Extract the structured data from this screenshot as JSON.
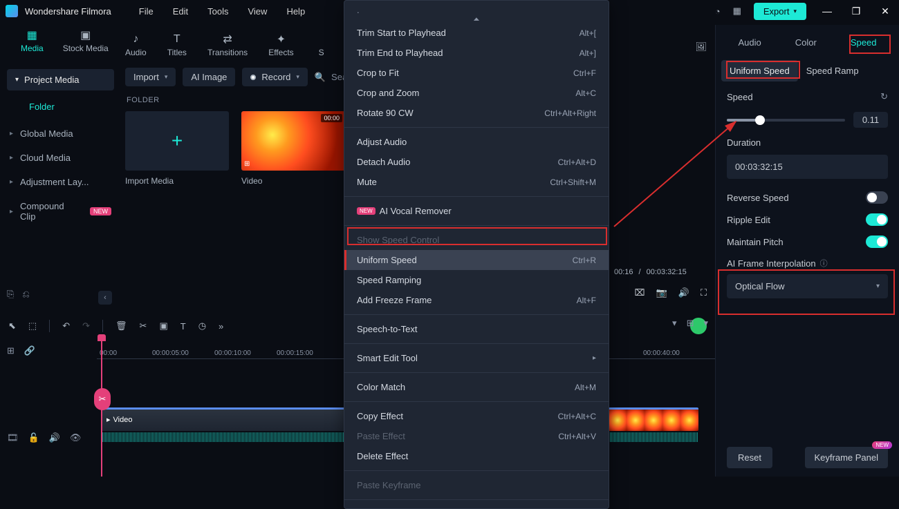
{
  "app": {
    "name": "Wondershare Filmora"
  },
  "menubar": [
    "File",
    "Edit",
    "Tools",
    "View",
    "Help"
  ],
  "export_label": "Export",
  "top_tabs": [
    {
      "label": "Media",
      "icon": "▦",
      "active": true
    },
    {
      "label": "Stock Media",
      "icon": "▣"
    },
    {
      "label": "Audio",
      "icon": "♪"
    },
    {
      "label": "Titles",
      "icon": "T"
    },
    {
      "label": "Transitions",
      "icon": "⇄"
    },
    {
      "label": "Effects",
      "icon": "✦"
    },
    {
      "label": "S",
      "icon": ""
    }
  ],
  "sidebar": {
    "header": "Project Media",
    "folder_label": "Folder",
    "items": [
      {
        "label": "Global Media"
      },
      {
        "label": "Cloud Media"
      },
      {
        "label": "Adjustment Lay..."
      },
      {
        "label": "Compound Clip",
        "new": true
      }
    ]
  },
  "toolbar": {
    "import": "Import",
    "ai_image": "AI Image",
    "record": "Record",
    "search_placeholder": "Sear"
  },
  "folder_heading": "FOLDER",
  "thumbs": {
    "import_media": "Import Media",
    "video": {
      "label": "Video",
      "duration": "00:00"
    }
  },
  "context_menu": {
    "groups": [
      [
        {
          "label": "Trim Start to Playhead",
          "shortcut": "Alt+["
        },
        {
          "label": "Trim End to Playhead",
          "shortcut": "Alt+]"
        },
        {
          "label": "Crop to Fit",
          "shortcut": "Ctrl+F"
        },
        {
          "label": "Crop and Zoom",
          "shortcut": "Alt+C"
        },
        {
          "label": "Rotate 90 CW",
          "shortcut": "Ctrl+Alt+Right"
        }
      ],
      [
        {
          "label": "Adjust Audio"
        },
        {
          "label": "Detach Audio",
          "shortcut": "Ctrl+Alt+D"
        },
        {
          "label": "Mute",
          "shortcut": "Ctrl+Shift+M"
        }
      ],
      [
        {
          "label": "AI Vocal Remover",
          "new": true
        }
      ],
      [
        {
          "label": "Show Speed Control",
          "disabled": true
        },
        {
          "label": "Uniform Speed",
          "shortcut": "Ctrl+R",
          "highlight": true
        },
        {
          "label": "Speed Ramping"
        },
        {
          "label": "Add Freeze Frame",
          "shortcut": "Alt+F"
        }
      ],
      [
        {
          "label": "Speech-to-Text"
        }
      ],
      [
        {
          "label": "Smart Edit Tool",
          "submenu": true
        }
      ],
      [
        {
          "label": "Color Match",
          "shortcut": "Alt+M"
        }
      ],
      [
        {
          "label": "Copy Effect",
          "shortcut": "Ctrl+Alt+C"
        },
        {
          "label": "Paste Effect",
          "shortcut": "Ctrl+Alt+V",
          "disabled": true
        },
        {
          "label": "Delete Effect"
        }
      ],
      [
        {
          "label": "Paste Keyframe",
          "disabled": true
        }
      ]
    ]
  },
  "preview": {
    "current": "00:16",
    "total": "00:03:32:15"
  },
  "timeline": {
    "ticks": [
      "00:00",
      "00:00:05:00",
      "00:00:10:00",
      "00:00:15:00",
      "00:00:40:00"
    ],
    "clip_label": "Video"
  },
  "right_panel": {
    "tabs": [
      "Audio",
      "Color",
      "Speed"
    ],
    "subtabs": [
      "Uniform Speed",
      "Speed Ramp"
    ],
    "speed_label": "Speed",
    "speed_value": "0.11",
    "duration_label": "Duration",
    "duration_value": "00:03:32:15",
    "reverse_label": "Reverse Speed",
    "ripple_label": "Ripple Edit",
    "pitch_label": "Maintain Pitch",
    "ai_interp_label": "AI Frame Interpolation",
    "ai_interp_value": "Optical Flow",
    "reset": "Reset",
    "keyframe_panel": "Keyframe Panel",
    "new_badge": "NEW"
  }
}
